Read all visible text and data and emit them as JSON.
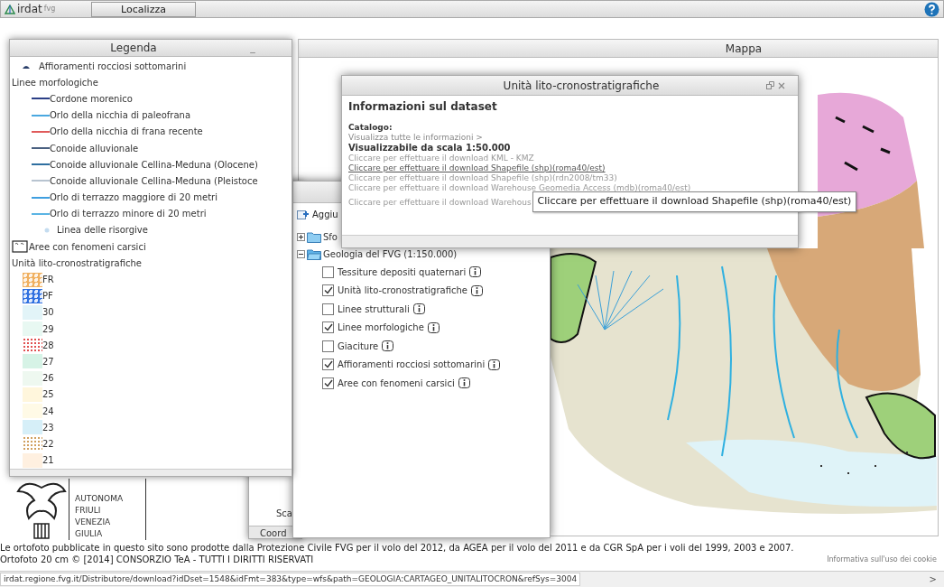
{
  "header": {
    "logo": "irdat",
    "logo_suffix": "fvg",
    "button": "Localizza"
  },
  "map": {
    "title": "Mappa"
  },
  "legend": {
    "title": "Legenda",
    "minimize": "_",
    "items": [
      {
        "kind": "point",
        "label": "Affioramenti rocciosi sottomarini",
        "color": "#2a3f6a"
      },
      {
        "kind": "heading",
        "label": "Linee morfologiche"
      },
      {
        "kind": "line",
        "label": "Cordone morenico",
        "color": "#2b3f86"
      },
      {
        "kind": "line",
        "label": "Orlo della nicchia di paleofrana",
        "color": "#4aa8e0"
      },
      {
        "kind": "line",
        "label": "Orlo della nicchia di frana recente",
        "color": "#e05a5a"
      },
      {
        "kind": "line",
        "label": "Conoide alluvionale",
        "color": "#4a6080"
      },
      {
        "kind": "line",
        "label": "Conoide alluvionale Cellina-Meduna (Olocene)",
        "color": "#2f6fa0"
      },
      {
        "kind": "line",
        "label": "Conoide alluvionale Cellina-Meduna (Pleistoce",
        "color": "#b8c4d0"
      },
      {
        "kind": "line",
        "label": "Orlo di terrazzo maggiore di 20 metri",
        "color": "#3f9fe0"
      },
      {
        "kind": "line",
        "label": "Orlo di terrazzo minore di 20 metri",
        "color": "#5ab4e4"
      },
      {
        "kind": "dot",
        "label": "Linea delle risorgive",
        "color": "#c4dcf0"
      },
      {
        "kind": "area",
        "label": "Aree con fenomeni carsici"
      },
      {
        "kind": "heading",
        "label": "Unità lito-cronostratigrafiche"
      },
      {
        "kind": "patterned",
        "label": "FR",
        "color": "#f0b060"
      },
      {
        "kind": "patterned",
        "label": "PF",
        "color": "#3070e0"
      },
      {
        "kind": "swatch",
        "label": "30",
        "color": "#e2f4f8"
      },
      {
        "kind": "swatch",
        "label": "29",
        "color": "#e8f8f2"
      },
      {
        "kind": "dotted",
        "label": "28",
        "color": "#e05050"
      },
      {
        "kind": "swatch",
        "label": "27",
        "color": "#d6f3e6"
      },
      {
        "kind": "swatch",
        "label": "26",
        "color": "#eef8f0"
      },
      {
        "kind": "swatch",
        "label": "25",
        "color": "#fff6dc"
      },
      {
        "kind": "swatch",
        "label": "24",
        "color": "#fffae6"
      },
      {
        "kind": "swatch",
        "label": "23",
        "color": "#d6eff8"
      },
      {
        "kind": "dotted",
        "label": "22",
        "color": "#d0a060"
      },
      {
        "kind": "swatch",
        "label": "21",
        "color": "#fff0e0"
      }
    ]
  },
  "side_panel": {
    "labels": [
      "Sca",
      "Coord"
    ]
  },
  "layers": {
    "toolbar_label": "Aggiu",
    "tree": [
      {
        "label": "Sfo",
        "expanded": false
      },
      {
        "label": "Geologia del FVG (1:150.000)",
        "expanded": true,
        "children": [
          {
            "label": "Tessiture depositi quaternari",
            "checked": false
          },
          {
            "label": "Unità lito-cronostratigrafiche",
            "checked": true
          },
          {
            "label": "Linee strutturali",
            "checked": false
          },
          {
            "label": "Linee morfologiche",
            "checked": true
          },
          {
            "label": "Giaciture",
            "checked": false
          },
          {
            "label": "Affioramenti rocciosi sottomarini",
            "checked": true
          },
          {
            "label": "Aree con fenomeni carsici",
            "checked": true
          }
        ]
      }
    ]
  },
  "info": {
    "title": "Unità lito-cronostratigrafiche",
    "heading": "Informazioni sul dataset",
    "catalog_label": "Catalogo:",
    "info_link": "Visualizza tutte le informazioni >",
    "scale": "Visualizzabile da scala 1:50.000",
    "downloads": [
      {
        "label": "Cliccare per effettuare il download KML - KMZ",
        "hovered": false
      },
      {
        "label": "Cliccare per effettuare il download Shapefile (shp)(roma40/est)",
        "hovered": true
      },
      {
        "label": "Cliccare per effettuare il download Shapefile (shp)(rdn2008/tm33)",
        "hovered": false
      },
      {
        "label": "Cliccare per effettuare il download Warehouse Geomedia Access (mdb)(roma40/est)",
        "hovered": false
      },
      {
        "label": "Cliccare per effettuare il download Warehous",
        "hovered": false
      }
    ]
  },
  "tooltip": "Cliccare per effettuare il download Shapefile (shp)(roma40/est)",
  "region_logo": [
    "AUTONOMA",
    "FRIULI",
    "VENEZIA",
    "GIULIA"
  ],
  "footer": {
    "notice": "Le ortofoto pubblicate in questo sito sono prodotte dalla Protezione Civile FVG per il volo del 2012, da AGEA per il volo del 2011 e da CGR SpA per i voli del 1999, 2003 e 2007.",
    "copyright": "Ortofoto 20 cm © [2014] CONSORZIO TeA - TUTTI I DIRITTI RISERVATI",
    "cookie_link": "Informativa sull'uso dei cookie"
  },
  "status_bar": {
    "url": "irdat.regione.fvg.it/Distributore/download?idDset=1548&idFmt=383&type=wfs&path=GEOLOGIA:CARTAGEO_UNITALITOCRON&refSys=3004",
    "arrow": ">"
  }
}
